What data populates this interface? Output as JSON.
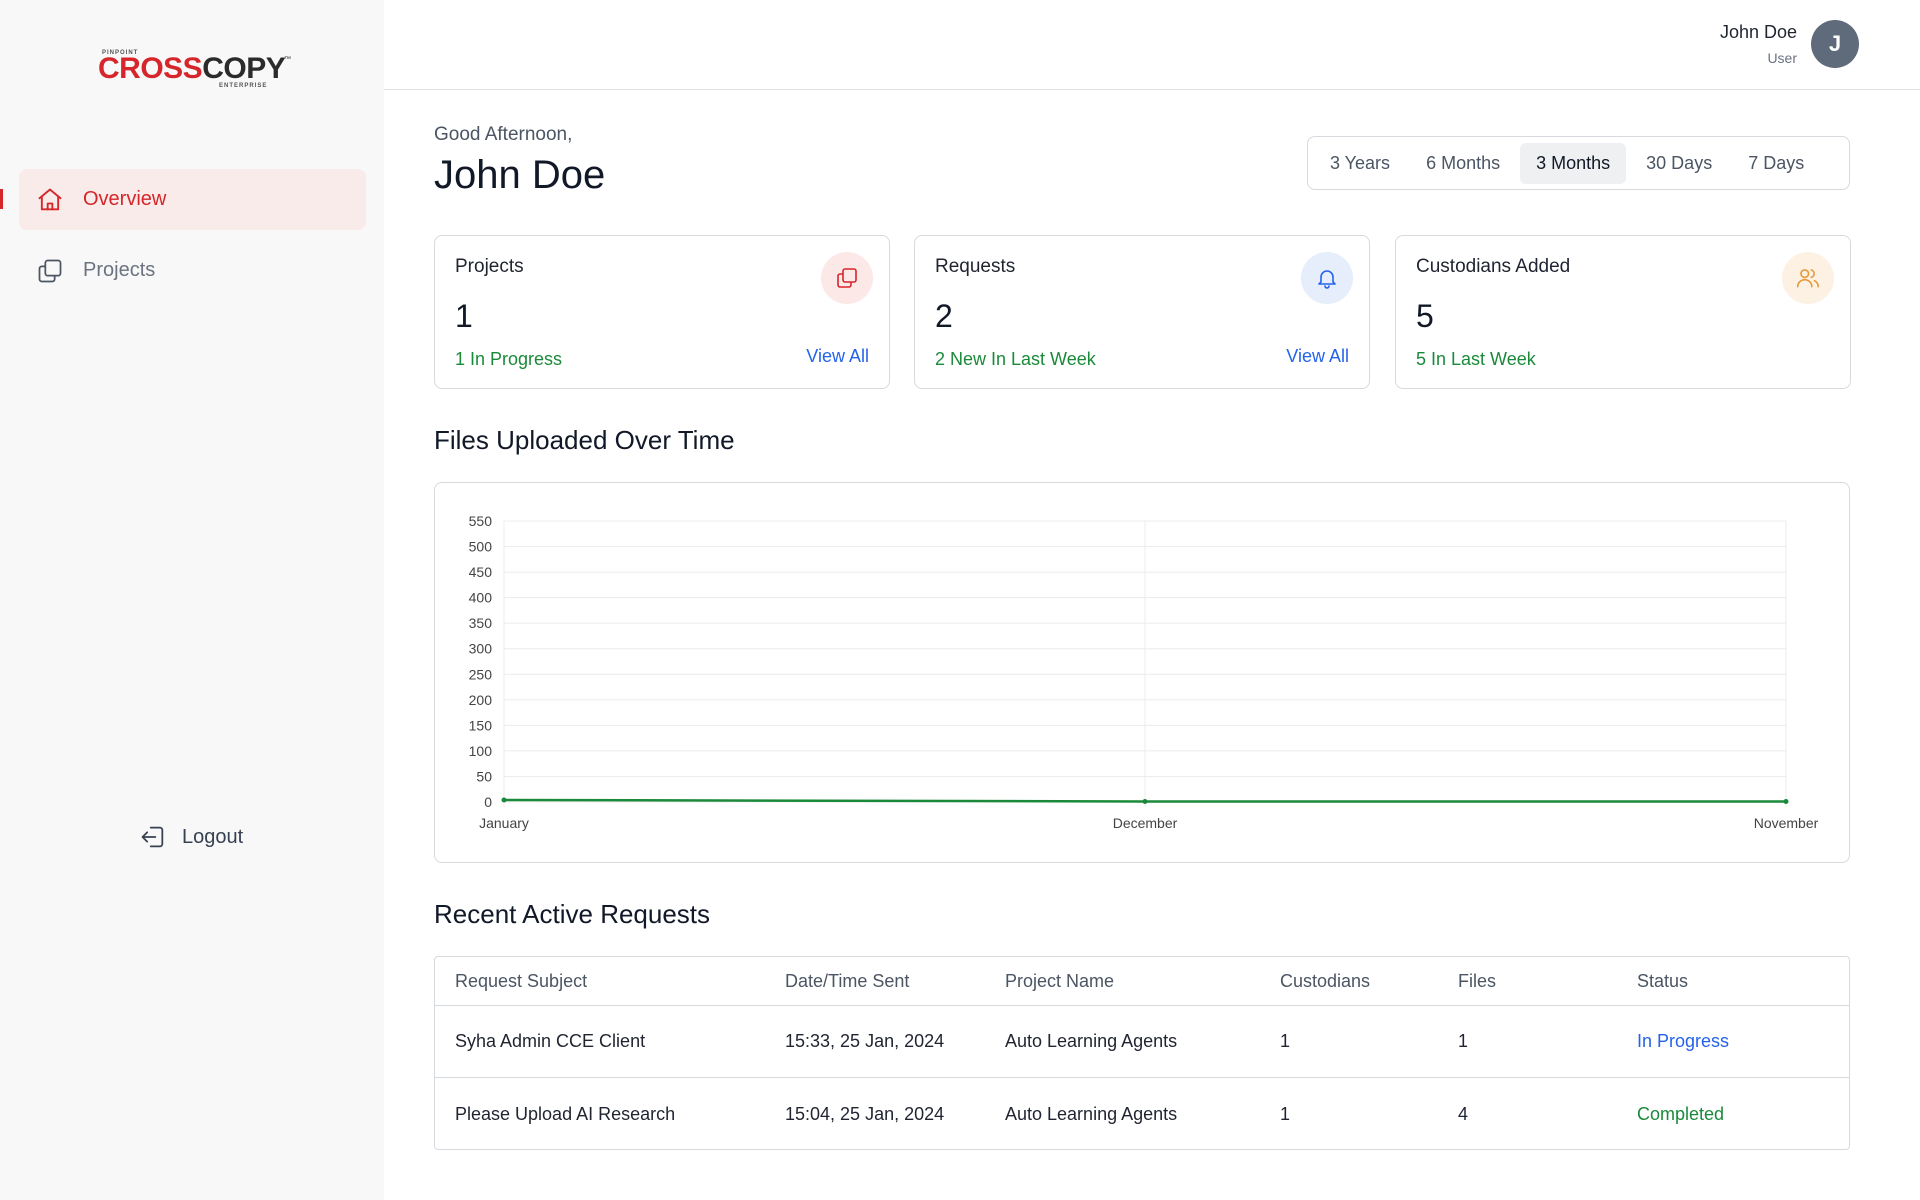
{
  "brand": {
    "top_text": "PINPOINT",
    "name_red": "CROSS",
    "name_dark": "COPY",
    "tm": "™",
    "bottom_text": "ENTERPRISE",
    "accent_color": "#d7262b"
  },
  "sidebar": {
    "items": [
      {
        "label": "Overview",
        "icon": "home-icon",
        "active": true
      },
      {
        "label": "Projects",
        "icon": "copy-icon",
        "active": false
      }
    ],
    "logout_label": "Logout"
  },
  "header": {
    "user_name": "John Doe",
    "user_role": "User",
    "avatar_initial": "J"
  },
  "greeting": {
    "salutation": "Good Afternoon,",
    "name": "John Doe"
  },
  "period": {
    "options": [
      "3 Years",
      "6 Months",
      "3 Months",
      "30 Days",
      "7 Days"
    ],
    "selected": "3 Months"
  },
  "cards": [
    {
      "title": "Projects",
      "value": "1",
      "sub": "1 In Progress",
      "link": "View All",
      "icon": "copy-icon",
      "icon_color": "#d7262b",
      "icon_bg": "#fde8e8"
    },
    {
      "title": "Requests",
      "value": "2",
      "sub": "2 New In Last Week",
      "link": "View All",
      "icon": "bell-icon",
      "icon_color": "#2563eb",
      "icon_bg": "#e6edfb"
    },
    {
      "title": "Custodians Added",
      "value": "5",
      "sub": "5 In Last Week",
      "link": "",
      "icon": "users-icon",
      "icon_color": "#e59a3a",
      "icon_bg": "#fdf1e3"
    }
  ],
  "chart_section_title": "Files Uploaded Over Time",
  "chart_data": {
    "type": "line",
    "categories": [
      "January",
      "December",
      "November"
    ],
    "series": [
      {
        "values": [
          4,
          1,
          1
        ]
      }
    ],
    "ylim": [
      0,
      550
    ],
    "yticks": [
      0,
      50,
      100,
      150,
      200,
      250,
      300,
      350,
      400,
      450,
      500,
      550
    ],
    "grid": true,
    "line_color": "#1a8a3a"
  },
  "table_section_title": "Recent Active Requests",
  "table": {
    "columns": [
      "Request Subject",
      "Date/Time Sent",
      "Project Name",
      "Custodians",
      "Files",
      "Status"
    ],
    "rows": [
      [
        "Syha Admin CCE Client",
        "15:33, 25 Jan, 2024",
        "Auto Learning Agents",
        "1",
        "1",
        "In Progress"
      ],
      [
        "Please Upload AI Research",
        "15:04, 25 Jan, 2024",
        "Auto Learning Agents",
        "1",
        "4",
        "Completed"
      ]
    ]
  }
}
